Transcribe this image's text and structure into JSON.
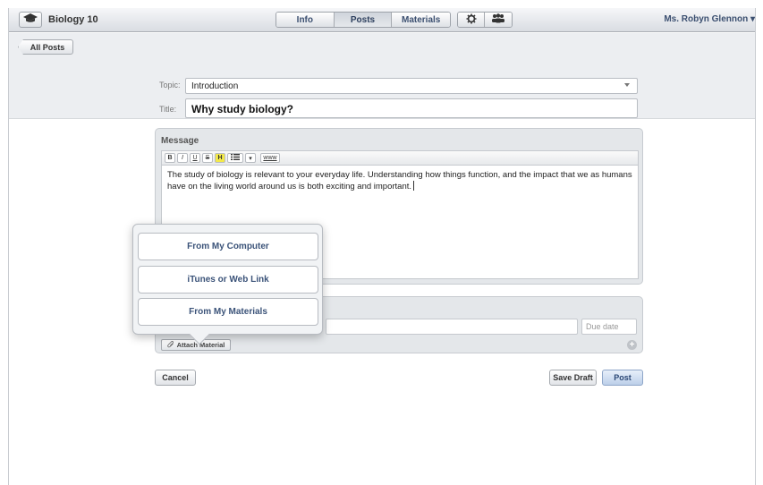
{
  "header": {
    "course_title": "Biology 10",
    "tabs": [
      {
        "label": "Info",
        "active": false
      },
      {
        "label": "Posts",
        "active": true
      },
      {
        "label": "Materials",
        "active": false
      }
    ],
    "tool_icons": [
      "gear-icon",
      "people-icon"
    ],
    "user_menu": "Ms. Robyn Glennon ▾"
  },
  "subbar": {
    "back_label": "All Posts",
    "topic_label": "Topic:",
    "topic_value": "Introduction",
    "title_label": "Title:",
    "title_value": "Why study biology?"
  },
  "message": {
    "panel_title": "Message",
    "toolbar": [
      "B",
      "I",
      "U",
      "S",
      "H",
      "list",
      "▾",
      "www"
    ],
    "body_line1": "The study of biology is relevant to your everyday life. Understanding how things function, and the impact that we as humans",
    "body_line2": "have on the living world around us is both exciting and important."
  },
  "materials": {
    "due_placeholder": "Due date",
    "attach_label": "Attach Material"
  },
  "actions": {
    "cancel": "Cancel",
    "save_draft": "Save Draft",
    "post": "Post"
  },
  "popover": {
    "items": [
      "From My Computer",
      "iTunes or Web Link",
      "From My Materials"
    ]
  },
  "colors": {
    "accent_text": "#3b5379",
    "highlight": "#f3e94a"
  }
}
